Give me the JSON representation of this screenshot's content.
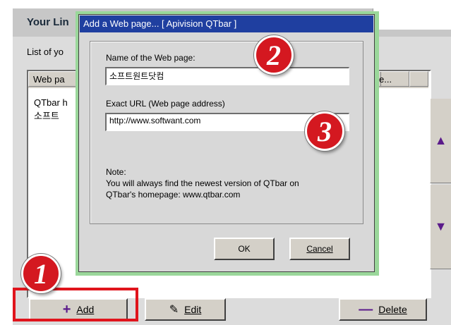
{
  "background_window": {
    "title": "Your Lin",
    "list_caption": "List of yo",
    "columns": [
      "Web pa",
      "e..."
    ],
    "rows": [
      "QTbar h",
      "소프트"
    ],
    "side_up_icon": "triangle-up",
    "side_down_icon": "triangle-down",
    "buttons": {
      "add": "Add",
      "edit": "Edit",
      "delete": "Delete"
    }
  },
  "dialog": {
    "title": "Add a Web page... [ Apivision QTbar ]",
    "name_label": "Name of the Web page:",
    "name_value": "소프트원트닷컴",
    "url_label": "Exact URL (Web page address)",
    "url_value": "http://www.softwant.com",
    "note_title": "Note:",
    "note_line1": "You will always find the newest version of QTbar on",
    "note_line2": "QTbar's homepage: www.qtbar.com",
    "ok_label": "OK",
    "cancel_label": "Cancel"
  },
  "annotations": {
    "step1": "1",
    "step2": "2",
    "step3": "3"
  },
  "colors": {
    "highlight_red": "#e0141c",
    "titlebar_blue": "#1f3fa0",
    "dialog_shadow_green": "#9ad79a",
    "arrow_purple": "#5a1a8a"
  }
}
